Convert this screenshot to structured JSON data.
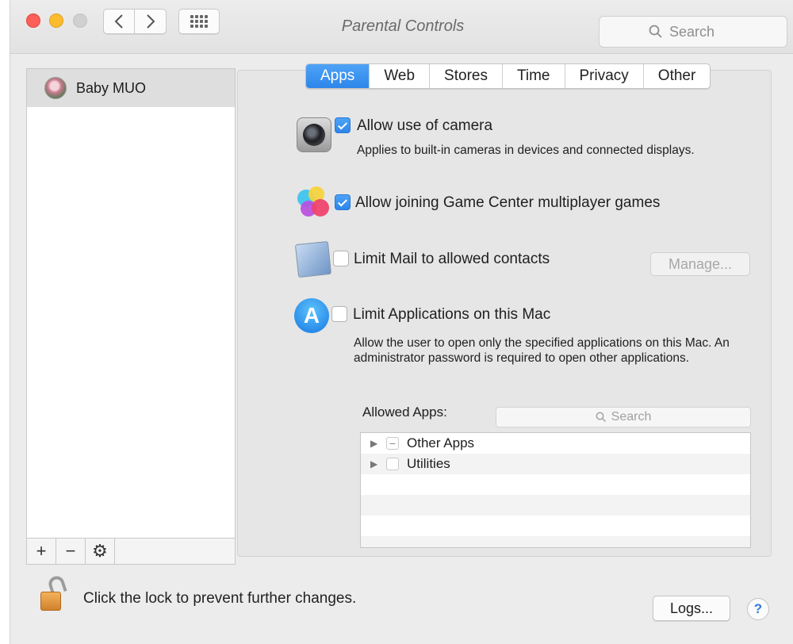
{
  "window": {
    "title": "Parental Controls"
  },
  "toolbar": {
    "search_placeholder": "Search"
  },
  "users": [
    {
      "name": "Baby MUO"
    }
  ],
  "list_toolbar": {
    "add": "+",
    "remove": "−",
    "gear": "⚙"
  },
  "tabs": [
    {
      "label": "Apps",
      "active": true
    },
    {
      "label": "Web"
    },
    {
      "label": "Stores"
    },
    {
      "label": "Time"
    },
    {
      "label": "Privacy"
    },
    {
      "label": "Other"
    }
  ],
  "options": {
    "camera": {
      "label": "Allow use of camera",
      "description": "Applies to built-in cameras in devices and connected displays.",
      "checked": true
    },
    "game_center": {
      "label": "Allow joining Game Center multiplayer games",
      "checked": true
    },
    "mail": {
      "label": "Limit Mail to allowed contacts",
      "checked": false,
      "manage_label": "Manage..."
    },
    "applications": {
      "label": "Limit Applications on this Mac",
      "description": "Allow the user to open only the specified applications on this Mac. An administrator password is required to open other applications.",
      "checked": false
    }
  },
  "allowed_apps": {
    "label": "Allowed Apps:",
    "search_placeholder": "Search",
    "items": [
      {
        "name": "Other Apps",
        "state": "−"
      },
      {
        "name": "Utilities",
        "state": ""
      }
    ]
  },
  "footer": {
    "lock_text": "Click the lock to prevent further changes.",
    "logs_label": "Logs...",
    "help_label": "?"
  },
  "colors": {
    "accent": "#2d86ea",
    "close": "#fc5f57",
    "minimize": "#fdbc2e"
  }
}
